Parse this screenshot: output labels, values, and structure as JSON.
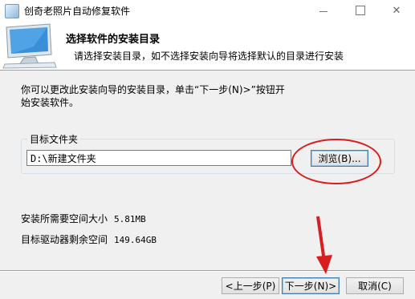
{
  "window": {
    "title": "创奇老照片自动修复软件",
    "minimize_glyph": "—",
    "close_glyph": "✕"
  },
  "header": {
    "title": "选择软件的安装目录",
    "subtitle": "请选择安装目录，如不选择安装向导将选择默认的目录进行安装"
  },
  "description": "你可以更改此安装向导的安装目录，单击“下一步(N)>”按钮开始安装软件。",
  "target": {
    "group_label": "目标文件夹",
    "path_value": "D:\\新建文件夹",
    "browse_label": "浏览(B)..."
  },
  "space": {
    "required_label": "安装所需要空间大小",
    "required_value": "5.81MB",
    "free_label": "目标驱动器剩余空间",
    "free_value": "149.64GB"
  },
  "buttons": {
    "back": "<上一步(P)",
    "next": "下一步(N)>",
    "cancel": "取消(C)"
  },
  "colors": {
    "annotation_red": "#d81e1e"
  }
}
